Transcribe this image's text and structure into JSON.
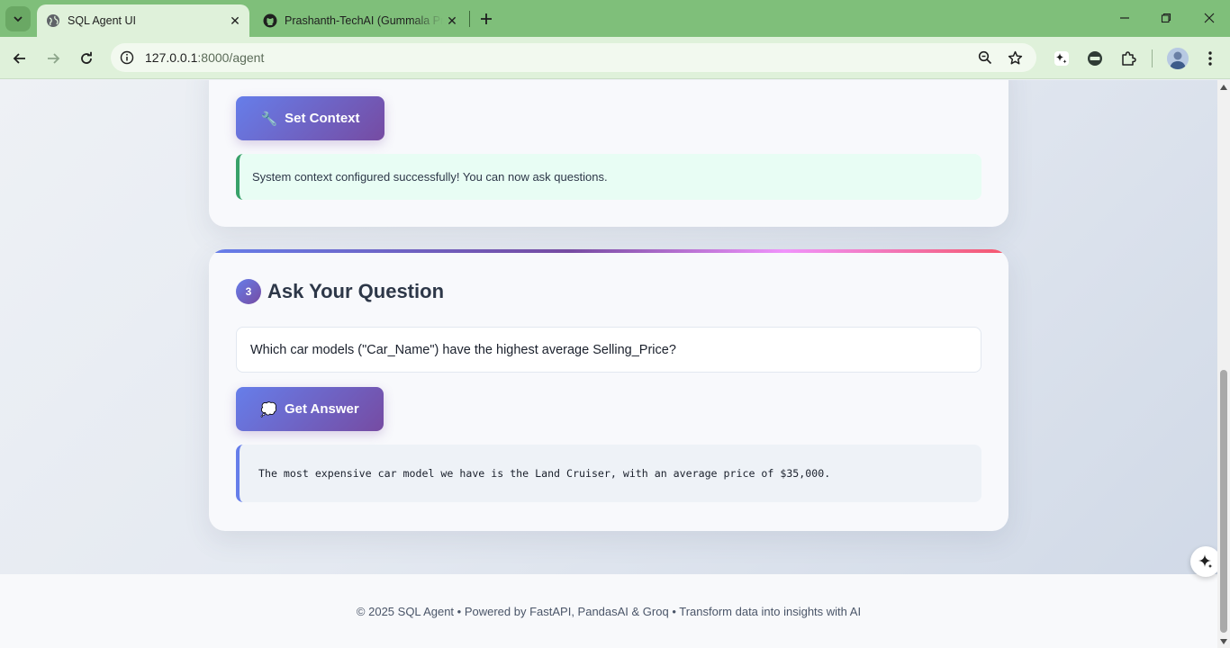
{
  "browser": {
    "tabs": [
      {
        "title": "SQL Agent UI",
        "active": true,
        "icon": "globe-icon"
      },
      {
        "title": "Prashanth-TechAI (Gummala Pr",
        "active": false,
        "icon": "github-icon"
      }
    ],
    "url_host": "127.0.0.1",
    "url_path": ":8000/agent",
    "accent_color": "#7fbf7a"
  },
  "page": {
    "context_section": {
      "button_icon": "🔧",
      "button_label": "Set Context",
      "status_message": "System context configured successfully! You can now ask questions."
    },
    "question_section": {
      "step_number": "3",
      "title": "Ask Your Question",
      "question_value": "Which car models (\"Car_Name\") have the highest average Selling_Price?",
      "button_icon": "💭",
      "button_label": "Get Answer",
      "answer_text": "The most expensive car model we have is the Land Cruiser, with an average price of $35,000."
    },
    "footer_text": "© 2025 SQL Agent • Powered by FastAPI, PandasAI & Groq • Transform data into insights with AI"
  },
  "colors": {
    "primary_gradient_start": "#667eea",
    "primary_gradient_end": "#764ba2",
    "success_border": "#38a169"
  }
}
